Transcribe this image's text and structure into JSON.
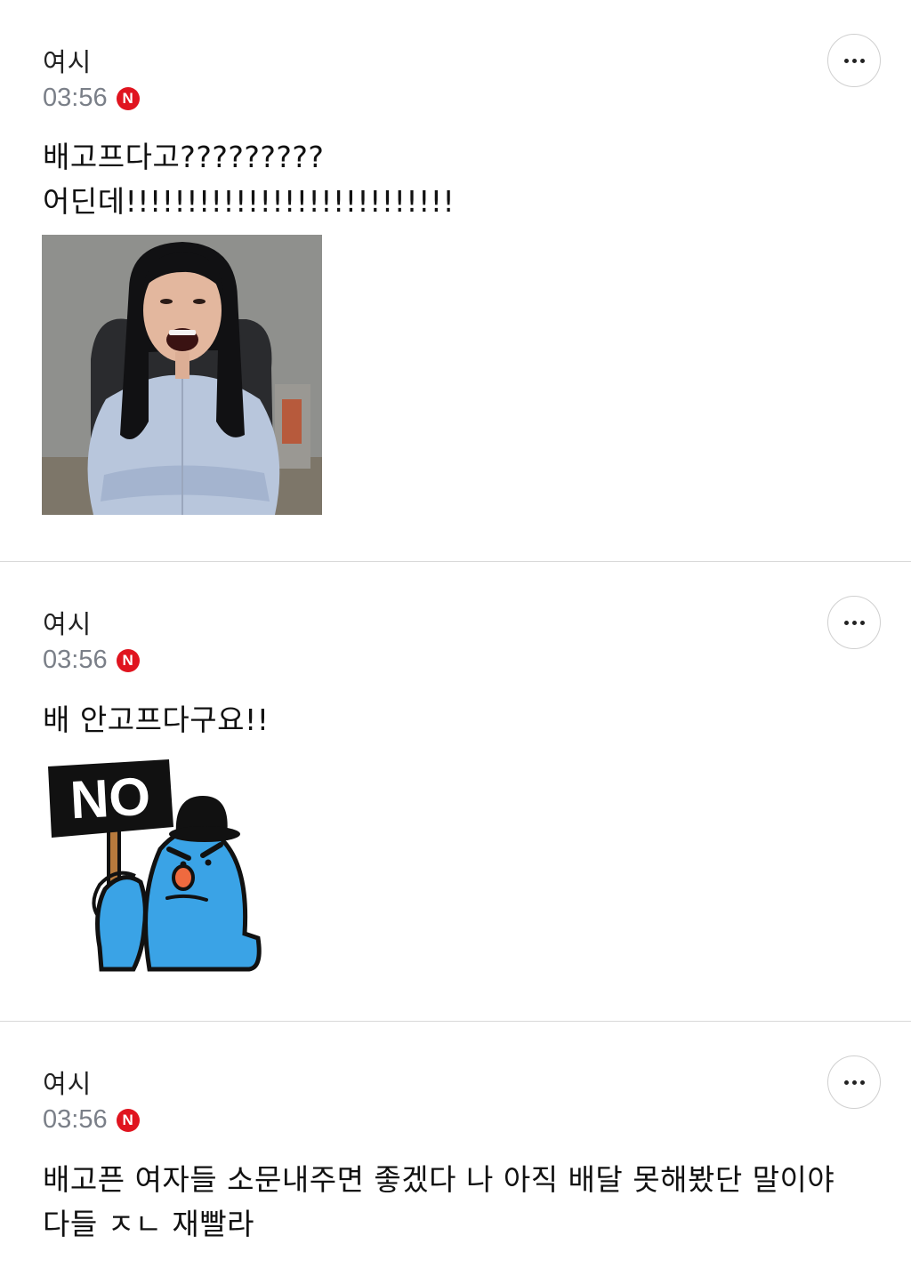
{
  "comments": [
    {
      "author": "여시",
      "time": "03:56",
      "badge": "N",
      "lines": [
        "배고프다고?????????",
        "어딘데!!!!!!!!!!!!!!!!!!!!!!!!!!!"
      ],
      "media": "photo"
    },
    {
      "author": "여시",
      "time": "03:56",
      "badge": "N",
      "lines": [
        "배 안고프다구요!!"
      ],
      "media": "sticker",
      "sticker_text": "NO"
    },
    {
      "author": "여시",
      "time": "03:56",
      "badge": "N",
      "lines": [
        "배고픈 여자들 소문내주면 좋겠다 나 아직 배달 못해봤단 말이야",
        "다들 ㅈㄴ 재빨라"
      ]
    }
  ],
  "icons": {
    "more": "more-horizontal-icon",
    "new": "new-badge-icon"
  },
  "colors": {
    "badge": "#e0141f",
    "time": "#7a7f88",
    "divider": "#d9d9d9",
    "sticker_character": "#3aa3e6"
  }
}
